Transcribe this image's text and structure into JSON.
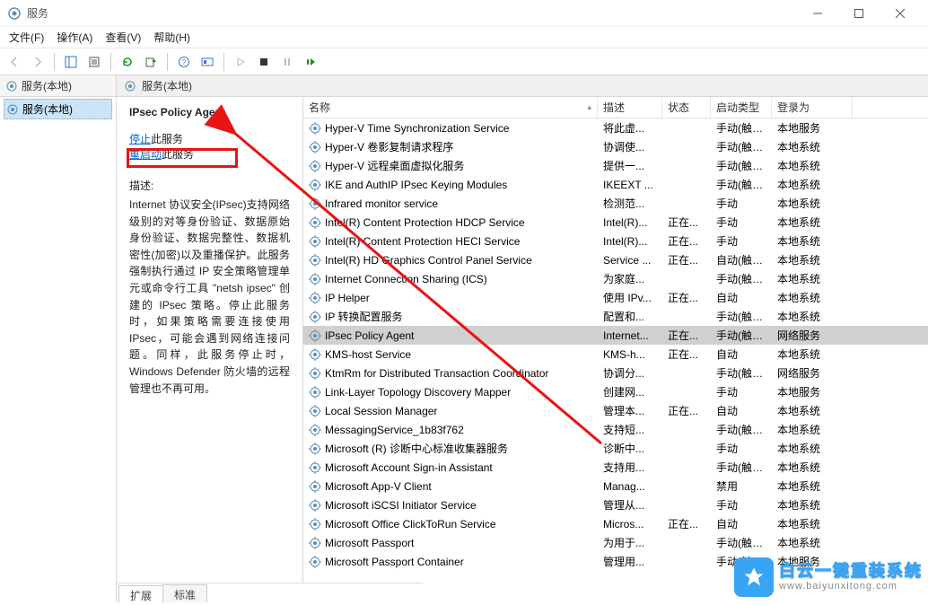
{
  "title": "服务",
  "menu": {
    "file": "文件(F)",
    "action": "操作(A)",
    "view": "查看(V)",
    "help": "帮助(H)"
  },
  "left": {
    "header": "服务(本地)",
    "node": "服务(本地)"
  },
  "right": {
    "header": "服务(本地)"
  },
  "detail": {
    "title": "IPsec Policy Agent",
    "stop_label": "停止",
    "stop_suffix": "此服务",
    "restart_label": "重启动",
    "restart_suffix": "此服务",
    "desc_label": "描述:",
    "desc": "Internet 协议安全(IPsec)支持网络级别的对等身份验证、数据原始身份验证、数据完整性、数据机密性(加密)以及重播保护。此服务强制执行通过 IP 安全策略管理单元或命令行工具 \"netsh ipsec\" 创建的 IPsec 策略。停止此服务时，如果策略需要连接使用 IPsec，可能会遇到网络连接问题。同样，此服务停止时，Windows Defender 防火墙的远程管理也不再可用。"
  },
  "columns": {
    "name": "名称",
    "desc": "描述",
    "status": "状态",
    "start": "启动类型",
    "logon": "登录为"
  },
  "tabs": {
    "extended": "扩展",
    "standard": "标准"
  },
  "rows": [
    {
      "name": "Hyper-V Time Synchronization Service",
      "desc": "将此虚...",
      "status": "",
      "start": "手动(触发...",
      "logon": "本地服务"
    },
    {
      "name": "Hyper-V 卷影复制请求程序",
      "desc": "协调使...",
      "status": "",
      "start": "手动(触发...",
      "logon": "本地系统"
    },
    {
      "name": "Hyper-V 远程桌面虚拟化服务",
      "desc": "提供一...",
      "status": "",
      "start": "手动(触发...",
      "logon": "本地系统"
    },
    {
      "name": "IKE and AuthIP IPsec Keying Modules",
      "desc": "IKEEXT ...",
      "status": "",
      "start": "手动(触发...",
      "logon": "本地系统"
    },
    {
      "name": "Infrared monitor service",
      "desc": "检测范...",
      "status": "",
      "start": "手动",
      "logon": "本地系统"
    },
    {
      "name": "Intel(R) Content Protection HDCP Service",
      "desc": "Intel(R)...",
      "status": "正在...",
      "start": "手动",
      "logon": "本地系统"
    },
    {
      "name": "Intel(R) Content Protection HECI Service",
      "desc": "Intel(R)...",
      "status": "正在...",
      "start": "手动",
      "logon": "本地系统"
    },
    {
      "name": "Intel(R) HD Graphics Control Panel Service",
      "desc": "Service ...",
      "status": "正在...",
      "start": "自动(触发...",
      "logon": "本地系统"
    },
    {
      "name": "Internet Connection Sharing (ICS)",
      "desc": "为家庭...",
      "status": "",
      "start": "手动(触发...",
      "logon": "本地系统"
    },
    {
      "name": "IP Helper",
      "desc": "使用 IPv...",
      "status": "正在...",
      "start": "自动",
      "logon": "本地系统"
    },
    {
      "name": "IP 转换配置服务",
      "desc": "配置和...",
      "status": "",
      "start": "手动(触发...",
      "logon": "本地系统"
    },
    {
      "name": "IPsec Policy Agent",
      "desc": "Internet...",
      "status": "正在...",
      "start": "手动(触发...",
      "logon": "网络服务",
      "selected": true
    },
    {
      "name": "KMS-host Service",
      "desc": "KMS-h...",
      "status": "正在...",
      "start": "自动",
      "logon": "本地系统"
    },
    {
      "name": "KtmRm for Distributed Transaction Coordinator",
      "desc": "协调分...",
      "status": "",
      "start": "手动(触发...",
      "logon": "网络服务"
    },
    {
      "name": "Link-Layer Topology Discovery Mapper",
      "desc": "创建网...",
      "status": "",
      "start": "手动",
      "logon": "本地服务"
    },
    {
      "name": "Local Session Manager",
      "desc": "管理本...",
      "status": "正在...",
      "start": "自动",
      "logon": "本地系统"
    },
    {
      "name": "MessagingService_1b83f762",
      "desc": "支持短...",
      "status": "",
      "start": "手动(触发...",
      "logon": "本地系统"
    },
    {
      "name": "Microsoft (R) 诊断中心标准收集器服务",
      "desc": "诊断中...",
      "status": "",
      "start": "手动",
      "logon": "本地系统"
    },
    {
      "name": "Microsoft Account Sign-in Assistant",
      "desc": "支持用...",
      "status": "",
      "start": "手动(触发...",
      "logon": "本地系统"
    },
    {
      "name": "Microsoft App-V Client",
      "desc": "Manag...",
      "status": "",
      "start": "禁用",
      "logon": "本地系统"
    },
    {
      "name": "Microsoft iSCSI Initiator Service",
      "desc": "管理从...",
      "status": "",
      "start": "手动",
      "logon": "本地系统"
    },
    {
      "name": "Microsoft Office ClickToRun Service",
      "desc": "Micros...",
      "status": "正在...",
      "start": "自动",
      "logon": "本地系统"
    },
    {
      "name": "Microsoft Passport",
      "desc": "为用于...",
      "status": "",
      "start": "手动(触发...",
      "logon": "本地系统"
    },
    {
      "name": "Microsoft Passport Container",
      "desc": "管理用...",
      "status": "",
      "start": "手动(触发...",
      "logon": "本地服务"
    }
  ],
  "watermark": {
    "main": "白云一键重装系统",
    "sub": "www.baiyunxitong.com"
  }
}
